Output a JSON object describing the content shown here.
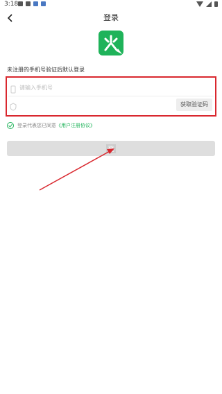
{
  "status_bar": {
    "time": "3:18"
  },
  "header": {
    "title": "登录"
  },
  "form": {
    "hint": "未注册的手机号验证后默认登录",
    "phone_placeholder": "请输入手机号",
    "code_value": "",
    "get_code_label": "获取验证码"
  },
  "agreement": {
    "prefix": "登录代表您已同意",
    "link": "《用户注册协议》"
  },
  "login_button": {
    "label": "登"
  },
  "colors": {
    "brand_green": "#1fb35a",
    "highlight_red": "#d9272e",
    "button_gray": "#dedede"
  },
  "icons": [
    "back-arrow-icon",
    "app-logo-icon",
    "phone-icon",
    "shield-icon",
    "check-circle-icon"
  ]
}
